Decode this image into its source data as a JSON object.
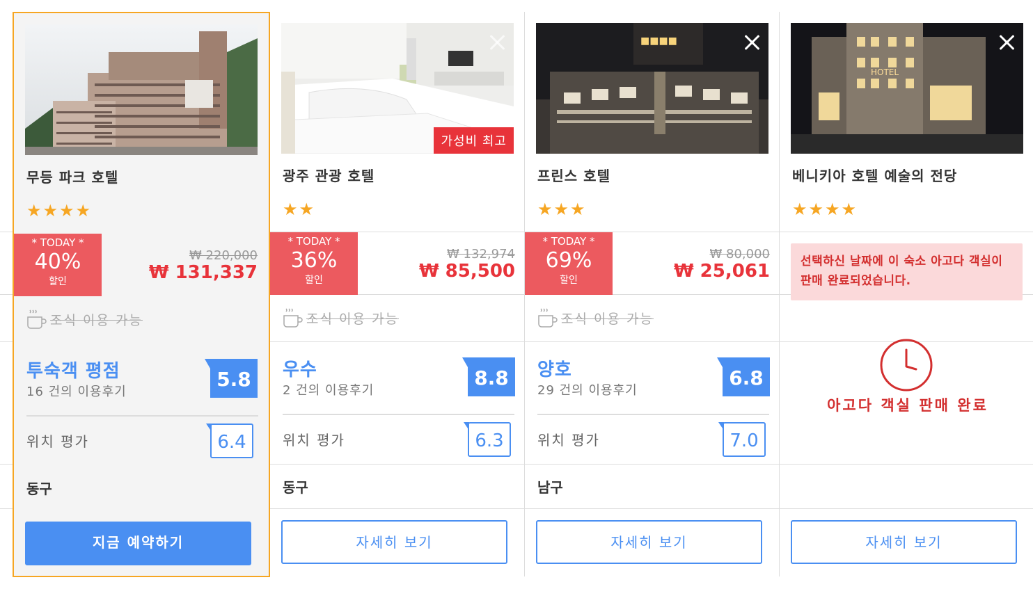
{
  "colors": {
    "accent_blue": "#4a8ff2",
    "sale_red": "#e8333a",
    "today_red": "#ec5a5f",
    "star_orange": "#f6a623",
    "highlight_border": "#f6a623"
  },
  "hotels": [
    {
      "name": "무등 파크 호텔",
      "stars": 4,
      "stars_text": "★★★★",
      "today_top": "* TODAY *",
      "discount": "40%",
      "discount_label": "할인",
      "old_price": "₩ 220,000",
      "new_price": "₩ 131,337",
      "breakfast": "조식 이용 가능",
      "rating_label": "투숙객 평점",
      "review_count": "16 건의 이용후기",
      "score": "5.8",
      "location_label": "위치 평가",
      "location_score": "6.4",
      "district": "동구",
      "button": "지금 예약하기"
    },
    {
      "name": "광주 관광 호텔",
      "stars": 2,
      "stars_text": "★★",
      "badge": "가성비 최고",
      "today_top": "* TODAY *",
      "discount": "36%",
      "discount_label": "할인",
      "old_price": "₩ 132,974",
      "new_price": "₩ 85,500",
      "breakfast": "조식 이용 가능",
      "rating_label": "우수",
      "review_count": "2 건의 이용후기",
      "score": "8.8",
      "location_label": "위치 평가",
      "location_score": "6.3",
      "district": "동구",
      "button": "자세히 보기"
    },
    {
      "name": "프린스 호텔",
      "stars": 3,
      "stars_text": "★★★",
      "today_top": "* TODAY *",
      "discount": "69%",
      "discount_label": "할인",
      "old_price": "₩ 80,000",
      "new_price": "₩ 25,061",
      "breakfast": "조식 이용 가능",
      "rating_label": "양호",
      "review_count": "29 건의 이용후기",
      "score": "6.8",
      "location_label": "위치 평가",
      "location_score": "7.0",
      "district": "남구",
      "button": "자세히 보기"
    },
    {
      "name": "베니키아 호텔 예술의 전당",
      "stars": 4,
      "stars_text": "★★★★",
      "soldout_message": "선택하신 날짜에 이 숙소 아고다 객실이 판매 완료되었습니다.",
      "soldout_label": "아고다 객실 판매 완료",
      "button": "자세히 보기"
    }
  ],
  "icons": [
    "close-icon",
    "coffee-cup-icon",
    "star-icon",
    "clock-icon"
  ]
}
